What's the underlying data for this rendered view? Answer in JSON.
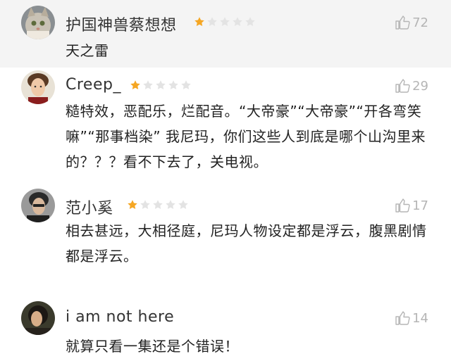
{
  "comments": [
    {
      "username": "护国神兽蔡想想",
      "rating": 1,
      "max_rating": 5,
      "likes": "72",
      "text": "天之雷",
      "avatar": "cat-avatar"
    },
    {
      "username": "Creep_",
      "rating": 1,
      "max_rating": 5,
      "likes": "29",
      "text": "糙特效，恶配乐，烂配音。“大帝豪”“大帝豪”“开各弯笑嘛”“那事档染” 我尼玛，你们这些人到底是哪个山沟里来的？？？看不下去了，关电视。",
      "avatar": "person-avatar"
    },
    {
      "username": "范小奚",
      "rating": 1,
      "max_rating": 5,
      "likes": "17",
      "text": "相去甚远，大相径庭，尼玛人物设定都是浮云，腹黑剧情都是浮云。",
      "avatar": "person-avatar"
    },
    {
      "username": "i am not here",
      "rating": 1,
      "max_rating": 5,
      "likes": "14",
      "text": "就算只看一集还是个错误！",
      "avatar": "person-avatar"
    }
  ],
  "colors": {
    "star_filled": "#f5a623",
    "star_empty": "#e3e3e3",
    "like_gray": "#b5b5b5",
    "highlight_bg": "#f4f4f4"
  }
}
